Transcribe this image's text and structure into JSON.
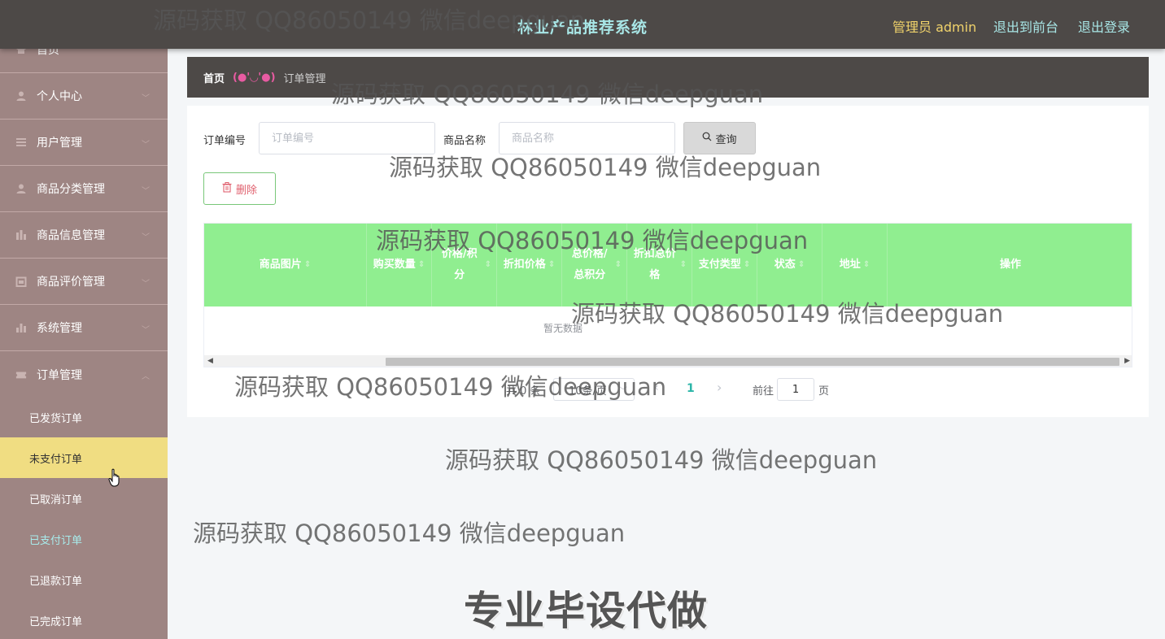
{
  "header": {
    "title": "林业产品推荐系统",
    "admin": "管理员 admin",
    "to_front": "退出到前台",
    "logout": "退出登录"
  },
  "sidebar": {
    "items": [
      {
        "label": "首页",
        "icon": "home-icon"
      },
      {
        "label": "个人中心",
        "icon": "user-icon"
      },
      {
        "label": "用户管理",
        "icon": "list-icon"
      },
      {
        "label": "商品分类管理",
        "icon": "user-icon"
      },
      {
        "label": "商品信息管理",
        "icon": "chart-icon"
      },
      {
        "label": "商品评价管理",
        "icon": "calendar-icon"
      },
      {
        "label": "系统管理",
        "icon": "bar-chart-icon"
      },
      {
        "label": "订单管理",
        "icon": "ticket-icon"
      }
    ],
    "sub_items": [
      {
        "label": "已发货订单"
      },
      {
        "label": "未支付订单"
      },
      {
        "label": "已取消订单"
      },
      {
        "label": "已支付订单"
      },
      {
        "label": "已退款订单"
      },
      {
        "label": "已完成订单"
      }
    ]
  },
  "breadcrumb": {
    "home": "首页",
    "separator": "(●'◡'●)",
    "current": "订单管理"
  },
  "search": {
    "order_no_label": "订单编号",
    "order_no_placeholder": "订单编号",
    "product_label": "商品名称",
    "product_placeholder": "商品名称",
    "query_button": "查询"
  },
  "actions": {
    "delete_button": "删除"
  },
  "table": {
    "columns": [
      {
        "label": "商品图片"
      },
      {
        "label": "购买数量"
      },
      {
        "label": "价格/积分"
      },
      {
        "label": "折扣价格"
      },
      {
        "label": "总价格/总积分"
      },
      {
        "label": "折扣总价格"
      },
      {
        "label": "支付类型"
      },
      {
        "label": "状态"
      },
      {
        "label": "地址"
      },
      {
        "label": "操作"
      }
    ],
    "empty_text": "暂无数据"
  },
  "pagination": {
    "total": "共 0 条",
    "page_size": "10条/页",
    "current_page": "1",
    "goto_label": "前往",
    "goto_value": "1",
    "unit": "页"
  },
  "watermark": {
    "text": "源码获取 QQ86050149 微信deepguan",
    "slogan": "专业毕设代做"
  }
}
